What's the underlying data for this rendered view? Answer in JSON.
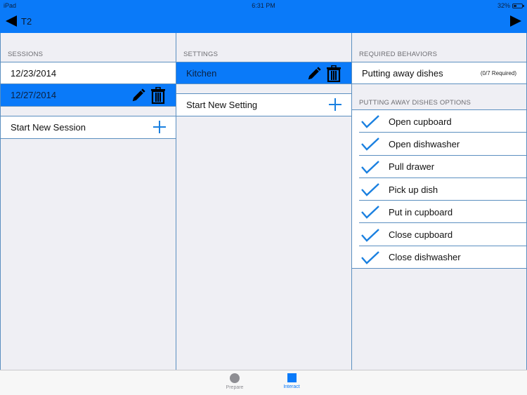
{
  "status_bar": {
    "device": "iPad",
    "time": "6:31 PM",
    "battery": "32%"
  },
  "nav": {
    "back_label": "T2",
    "back_icon": "triangle-left",
    "forward_icon": "triangle-right"
  },
  "sessions": {
    "header": "SESSIONS",
    "items": [
      {
        "label": "12/23/2014",
        "selected": false
      },
      {
        "label": "12/27/2014",
        "selected": true
      }
    ],
    "new_label": "Start New Session"
  },
  "settings": {
    "header": "SETTINGS",
    "items": [
      {
        "label": "Kitchen",
        "selected": true
      }
    ],
    "new_label": "Start New Setting"
  },
  "behaviors": {
    "header": "REQUIRED BEHAVIORS",
    "items": [
      {
        "label": "Putting away dishes",
        "count": "(0/7 Required)"
      }
    ]
  },
  "options": {
    "header": "PUTTING AWAY DISHES OPTIONS",
    "items": [
      {
        "label": "Open cupboard",
        "checked": true
      },
      {
        "label": "Open dishwasher",
        "checked": true
      },
      {
        "label": "Pull drawer",
        "checked": true
      },
      {
        "label": "Pick up dish",
        "checked": true
      },
      {
        "label": "Put in cupboard",
        "checked": true
      },
      {
        "label": "Close cupboard",
        "checked": true
      },
      {
        "label": "Close dishwasher",
        "checked": true
      }
    ]
  },
  "tabbar": {
    "tabs": [
      {
        "label": "Prepare",
        "active": false,
        "color": "#8e8e93"
      },
      {
        "label": "Interact",
        "active": true,
        "color": "#0a7af9"
      }
    ]
  },
  "colors": {
    "accent": "#0a7af9",
    "divider": "#5b8fc0",
    "check": "#1a80e0"
  }
}
